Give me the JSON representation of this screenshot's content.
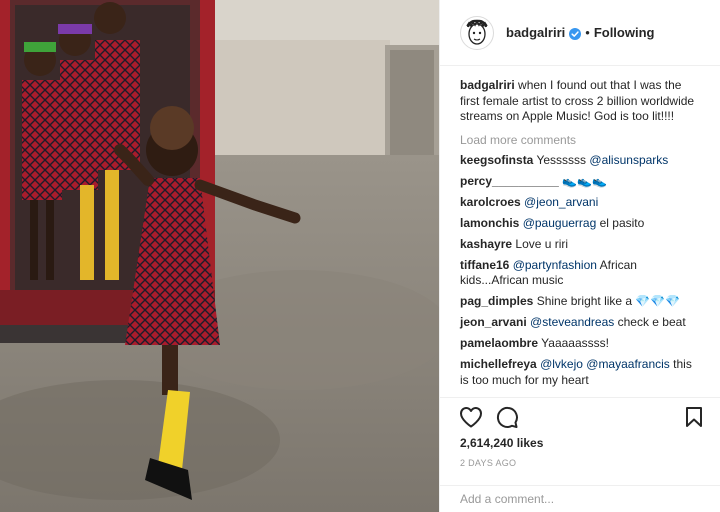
{
  "header": {
    "username": "badgalriri",
    "separator": "•",
    "follow_status": "Following"
  },
  "caption": {
    "username": "badgalriri",
    "text": "when I found out that I was the first female artist to cross 2 billion worldwide streams on Apple Music! God is too lit!!!!"
  },
  "load_more_label": "Load more comments",
  "comments": [
    {
      "user": "keegsofinsta",
      "pre": "Yessssss ",
      "mention": "@alisunsparks",
      "post": ""
    },
    {
      "user": "percy__________",
      "pre": "👟👟👟",
      "mention": "",
      "post": ""
    },
    {
      "user": "karolcroes",
      "pre": "",
      "mention": "@jeon_arvani",
      "post": ""
    },
    {
      "user": "lamonchis",
      "pre": "",
      "mention": "@pauguerrag",
      "post": " el pasito"
    },
    {
      "user": "kashayre",
      "pre": "Love u riri",
      "mention": "",
      "post": ""
    },
    {
      "user": "tiffane16",
      "pre": "",
      "mention": "@partynfashion",
      "post": " African kids...African music"
    },
    {
      "user": "pag_dimples",
      "pre": "Shine bright like a 💎💎💎",
      "mention": "",
      "post": ""
    },
    {
      "user": "jeon_arvani",
      "pre": "",
      "mention": "@steveandreas",
      "post": " check e beat"
    },
    {
      "user": "pamelaombre",
      "pre": "Yaaaaassss!",
      "mention": "",
      "post": ""
    },
    {
      "user": "michellefreya",
      "pre": "",
      "mention": "@lvkejo @mayaafrancis",
      "post": " this is too much for my heart"
    }
  ],
  "likes": "2,614,240 likes",
  "date": "2 DAYS AGO",
  "add_comment_placeholder": "Add a comment...",
  "icons": {
    "like": "heart-icon",
    "comment": "comment-bubble-icon",
    "save": "bookmark-icon",
    "verified": "verified-badge-icon"
  },
  "colors": {
    "text": "#262626",
    "muted": "#999999",
    "mention": "#003569",
    "verified": "#3897f0",
    "border": "#efefef"
  }
}
